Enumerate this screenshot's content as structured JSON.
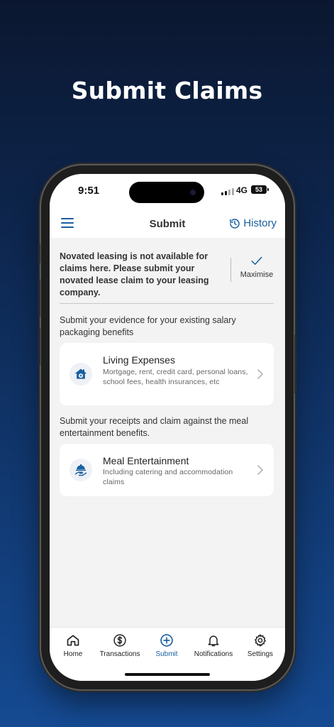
{
  "headline": "Submit Claims",
  "status_bar": {
    "time": "9:51",
    "network": "4G",
    "battery": "53"
  },
  "app_bar": {
    "title": "Submit",
    "history_label": "History"
  },
  "notice": {
    "text": "Novated leasing is not available for claims here. Please submit your novated lease claim to your leasing company.",
    "action_label": "Maximise"
  },
  "sections": [
    {
      "intro": "Submit your evidence for your existing salary packaging benefits",
      "card": {
        "title": "Living Expenses",
        "description": "Mortgage, rent, credit card, personal loans, school fees, health insurances, etc",
        "icon": "house-plus-icon"
      }
    },
    {
      "intro": "Submit your receipts and claim against the meal entertainment benefits.",
      "card": {
        "title": "Meal Entertainment",
        "description": "Including catering and accommodation claims",
        "icon": "serving-cloche-icon"
      }
    }
  ],
  "tabs": [
    {
      "label": "Home",
      "icon": "home-icon",
      "active": false
    },
    {
      "label": "Transactions",
      "icon": "dollar-circle-icon",
      "active": false
    },
    {
      "label": "Submit",
      "icon": "plus-circle-icon",
      "active": true
    },
    {
      "label": "Notifications",
      "icon": "bell-icon",
      "active": false
    },
    {
      "label": "Settings",
      "icon": "gear-icon",
      "active": false
    }
  ],
  "colors": {
    "accent": "#1a5fa0",
    "background_top": "#0b1730",
    "background_bottom": "#154a92"
  }
}
